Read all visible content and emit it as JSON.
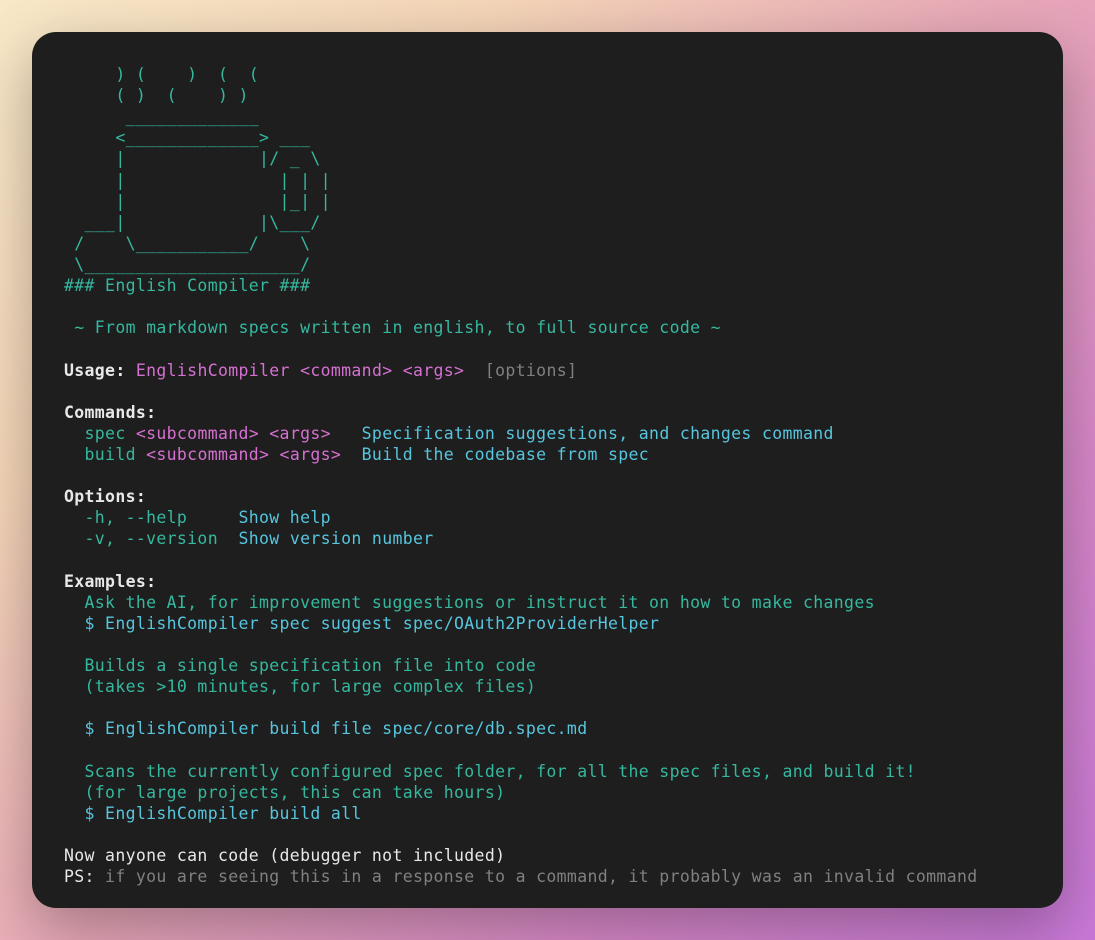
{
  "ascii_art": {
    "line1": "     ) (    )  (  (",
    "line2": "     ( )  (    ) )",
    "line3": "      _____________",
    "line4": "     <_____________> ___",
    "line5": "     |             |/ _ \\",
    "line6": "     |               | | |",
    "line7": "     |               |_| |",
    "line8": "  ___|             |\\___/",
    "line9": " /    \\___________/    \\",
    "line10": " \\_____________________/"
  },
  "title": "### English Compiler ###",
  "tagline": " ~ From markdown specs written in english, to full source code ~",
  "usage_label": "Usage:",
  "usage_program": " EnglishCompiler",
  "usage_command": " <command>",
  "usage_args": " <args>",
  "usage_options": "  [options]",
  "commands_label": "Commands:",
  "commands": {
    "spec_name": "  spec",
    "spec_args": " <subcommand> <args>",
    "spec_desc": "   Specification suggestions, and changes command",
    "build_name": "  build",
    "build_args": " <subcommand> <args>",
    "build_desc": "  Build the codebase from spec"
  },
  "options_label": "Options:",
  "options": {
    "help_flags": "  -h, --help",
    "help_desc": "     Show help",
    "version_flags": "  -v, --version",
    "version_desc": "  Show version number"
  },
  "examples_label": "Examples:",
  "examples": {
    "ex1_desc": "  Ask the AI, for improvement suggestions or instruct it on how to make changes",
    "ex1_cmd": "  $ EnglishCompiler spec suggest spec/OAuth2ProviderHelper",
    "ex2_desc1": "  Builds a single specification file into code",
    "ex2_desc2": "  (takes >10 minutes, for large complex files)",
    "ex2_cmd": "  $ EnglishCompiler build file spec/core/db.spec.md",
    "ex3_desc1": "  Scans the currently configured spec folder, for all the spec files, and build it!",
    "ex3_desc2": "  (for large projects, this can take hours)",
    "ex3_cmd": "  $ EnglishCompiler build all"
  },
  "footer_main": "Now anyone can code (debugger not included)",
  "footer_ps_label": "PS:",
  "footer_ps_text": " if you are seeing this in a response to a command, it probably was an invalid command"
}
